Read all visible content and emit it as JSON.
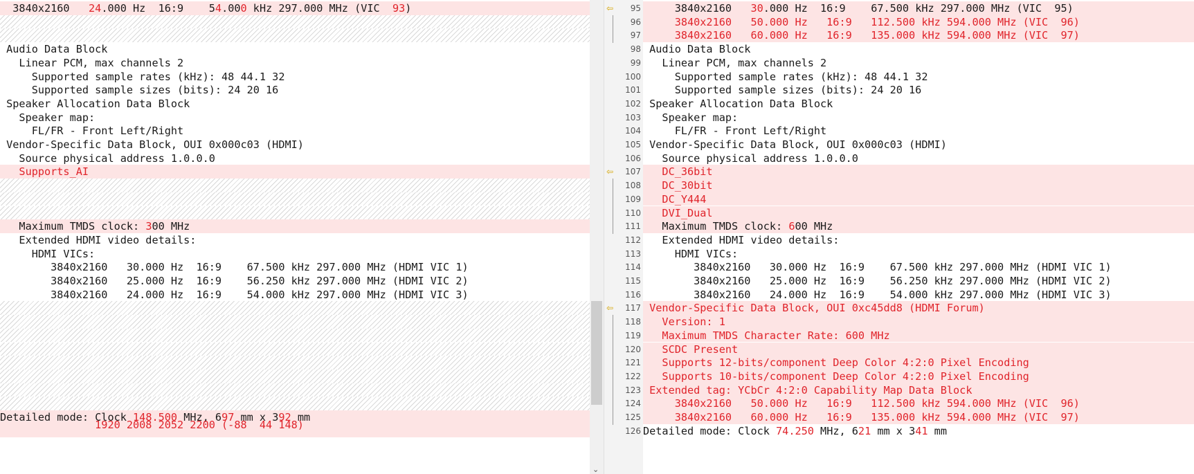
{
  "left": [
    {
      "text": "  3840x2160   ",
      "hl": "24",
      "mid": ".000 Hz  16:9    5",
      "hl2": "4",
      "mid2": ".00",
      "hl3": "0",
      "rest": " kHz 297.000 MHz (VIC  ",
      "hl4": "93",
      "end": ")",
      "type": "changed-mixed"
    },
    {
      "type": "hatch"
    },
    {
      "type": "hatch"
    },
    {
      "text": " Audio Data Block",
      "type": "normal"
    },
    {
      "text": "   Linear PCM, max channels 2",
      "type": "normal"
    },
    {
      "text": "     Supported sample rates (kHz): 48 44.1 32",
      "type": "normal"
    },
    {
      "text": "     Supported sample sizes (bits): 24 20 16",
      "type": "normal"
    },
    {
      "text": " Speaker Allocation Data Block",
      "type": "normal"
    },
    {
      "text": "   Speaker map:",
      "type": "normal"
    },
    {
      "text": "     FL/FR - Front Left/Right",
      "type": "normal"
    },
    {
      "text": " Vendor-Specific Data Block, OUI 0x000c03 (HDMI)",
      "type": "normal"
    },
    {
      "text": "   Source physical address 1.0.0.0",
      "type": "normal"
    },
    {
      "text": "   Supports_AI",
      "type": "changed"
    },
    {
      "type": "hatch"
    },
    {
      "type": "hatch"
    },
    {
      "type": "hatch"
    },
    {
      "text": "   Maximum TMDS clock: ",
      "hl": "3",
      "rest": "00 MHz",
      "type": "changed-part"
    },
    {
      "text": "   Extended HDMI video details:",
      "type": "normal"
    },
    {
      "text": "     HDMI VICs:",
      "type": "normal"
    },
    {
      "text": "        3840x2160   30.000 Hz  16:9    67.500 kHz 297.000 MHz (HDMI VIC 1)",
      "type": "normal"
    },
    {
      "text": "        3840x2160   25.000 Hz  16:9    56.250 kHz 297.000 MHz (HDMI VIC 2)",
      "type": "normal"
    },
    {
      "text": "        3840x2160   24.000 Hz  16:9    54.000 kHz 297.000 MHz (HDMI VIC 3)",
      "type": "normal"
    },
    {
      "type": "hatch"
    },
    {
      "type": "hatch"
    },
    {
      "type": "hatch"
    },
    {
      "type": "hatch"
    },
    {
      "type": "hatch"
    },
    {
      "type": "hatch"
    },
    {
      "type": "hatch"
    },
    {
      "type": "hatch"
    },
    {
      "text": "Detailed mode: Clock ",
      "hl": "148.500",
      "rest": " MHz, 6",
      "hl2": "97",
      "mid": " mm x 3",
      "hl3": "92",
      "end": " mm",
      "type": "changed-mixed2"
    },
    {
      "text": "               1920 2008 2052 2200 (-88  44 148)",
      "type": "changed-cut"
    }
  ],
  "right": [
    {
      "num": "95",
      "arrow": true,
      "text": "     3840x2160   ",
      "hl": "30",
      "rest": ".000 Hz  16:9    67.500 kHz 297.000 MHz (VIC  95)",
      "type": "changed-part"
    },
    {
      "num": "96",
      "text": "     3840x2160   50.000 Hz   16:9   112.500 kHz 594.000 MHz (VIC  96)",
      "type": "changed"
    },
    {
      "num": "97",
      "text": "     3840x2160   60.000 Hz   16:9   135.000 kHz 594.000 MHz (VIC  97)",
      "type": "changed"
    },
    {
      "num": "98",
      "text": " Audio Data Block",
      "type": "normal"
    },
    {
      "num": "99",
      "text": "   Linear PCM, max channels 2",
      "type": "normal"
    },
    {
      "num": "100",
      "text": "     Supported sample rates (kHz): 48 44.1 32",
      "type": "normal"
    },
    {
      "num": "101",
      "text": "     Supported sample sizes (bits): 24 20 16",
      "type": "normal"
    },
    {
      "num": "102",
      "text": " Speaker Allocation Data Block",
      "type": "normal"
    },
    {
      "num": "103",
      "text": "   Speaker map:",
      "type": "normal"
    },
    {
      "num": "104",
      "text": "     FL/FR - Front Left/Right",
      "type": "normal"
    },
    {
      "num": "105",
      "text": " Vendor-Specific Data Block, OUI 0x000c03 (HDMI)",
      "type": "normal"
    },
    {
      "num": "106",
      "text": "   Source physical address 1.0.0.0",
      "type": "normal"
    },
    {
      "num": "107",
      "arrow": true,
      "text": "   DC_36bit",
      "type": "changed"
    },
    {
      "num": "108",
      "text": "   DC_30bit",
      "type": "changed"
    },
    {
      "num": "109",
      "text": "   DC_Y444",
      "type": "changed"
    },
    {
      "num": "110",
      "text": "   DVI_Dual",
      "type": "changed"
    },
    {
      "num": "111",
      "text": "   Maximum TMDS clock: ",
      "hl": "6",
      "rest": "00 MHz",
      "type": "changed-part"
    },
    {
      "num": "112",
      "text": "   Extended HDMI video details:",
      "type": "normal"
    },
    {
      "num": "113",
      "text": "     HDMI VICs:",
      "type": "normal"
    },
    {
      "num": "114",
      "text": "        3840x2160   30.000 Hz  16:9    67.500 kHz 297.000 MHz (HDMI VIC 1)",
      "type": "normal"
    },
    {
      "num": "115",
      "text": "        3840x2160   25.000 Hz  16:9    56.250 kHz 297.000 MHz (HDMI VIC 2)",
      "type": "normal"
    },
    {
      "num": "116",
      "text": "        3840x2160   24.000 Hz  16:9    54.000 kHz 297.000 MHz (HDMI VIC 3)",
      "type": "normal"
    },
    {
      "num": "117",
      "arrow": true,
      "text": " Vendor-Specific Data Block, OUI 0xc45dd8 (HDMI Forum)",
      "type": "changed"
    },
    {
      "num": "118",
      "text": "   Version: 1",
      "type": "changed"
    },
    {
      "num": "119",
      "text": "   Maximum TMDS Character Rate: 600 MHz",
      "type": "changed"
    },
    {
      "num": "120",
      "text": "   SCDC Present",
      "type": "changed"
    },
    {
      "num": "121",
      "text": "   Supports 12-bits/component Deep Color 4:2:0 Pixel Encoding",
      "type": "changed"
    },
    {
      "num": "122",
      "text": "   Supports 10-bits/component Deep Color 4:2:0 Pixel Encoding",
      "type": "changed"
    },
    {
      "num": "123",
      "text": " Extended tag: YCbCr 4:2:0 Capability Map Data Block",
      "type": "changed"
    },
    {
      "num": "124",
      "text": "     3840x2160   50.000 Hz   16:9   112.500 kHz 594.000 MHz (VIC  96)",
      "type": "changed"
    },
    {
      "num": "125",
      "text": "     3840x2160   60.000 Hz   16:9   135.000 kHz 594.000 MHz (VIC  97)",
      "type": "changed"
    },
    {
      "num": "126",
      "text": "Detailed mode: Clock ",
      "hl": "74.250",
      "rest": " MHz, 6",
      "hl2": "21",
      "mid": " mm x 3",
      "hl3": "41",
      "end": " mm",
      "type": "mixed-normal"
    }
  ],
  "scroll_arrow": "⌄"
}
